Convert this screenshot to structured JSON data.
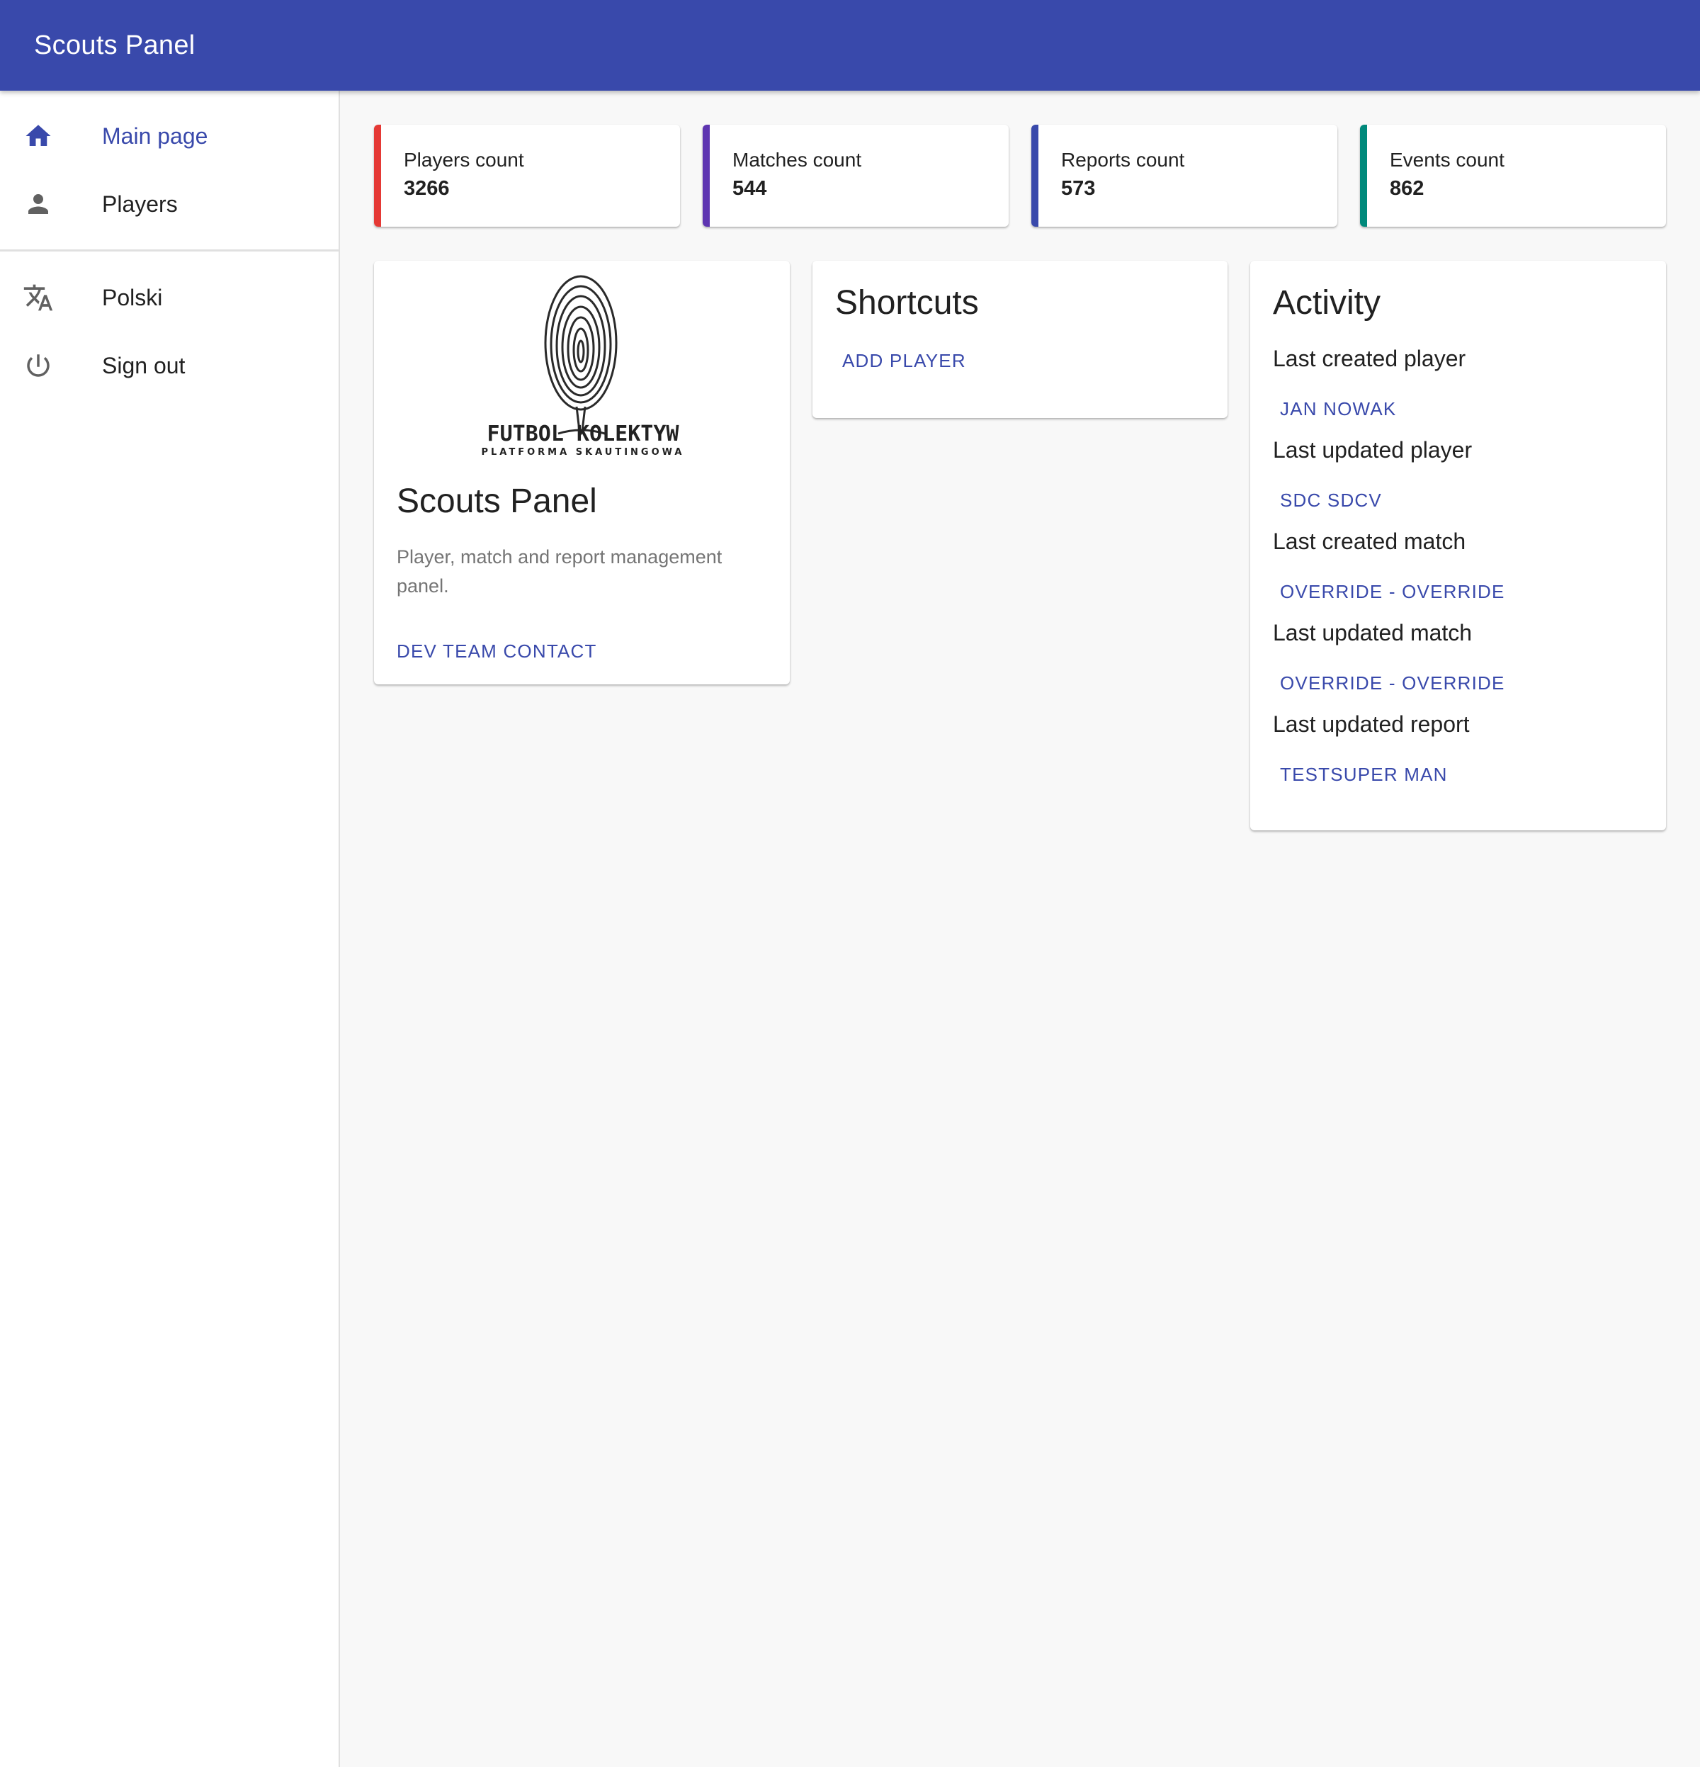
{
  "app": {
    "title": "Scouts Panel"
  },
  "sidebar": {
    "items": [
      {
        "label": "Main page",
        "icon": "home-icon",
        "active": true
      },
      {
        "label": "Players",
        "icon": "person-icon",
        "active": false
      },
      {
        "label": "Polski",
        "icon": "translate-icon",
        "active": false
      },
      {
        "label": "Sign out",
        "icon": "power-icon",
        "active": false
      }
    ]
  },
  "stats": [
    {
      "label": "Players count",
      "value": "3266",
      "color": "#e53935"
    },
    {
      "label": "Matches count",
      "value": "544",
      "color": "#5e35b1"
    },
    {
      "label": "Reports count",
      "value": "573",
      "color": "#3949ab"
    },
    {
      "label": "Events count",
      "value": "862",
      "color": "#00897b"
    }
  ],
  "about": {
    "logo_text": "FUTBOL KOLEKTYW",
    "logo_subtext": "PLATFORMA SKAUTINGOWA",
    "title": "Scouts Panel",
    "description": "Player, match and report management panel.",
    "contact_label": "DEV TEAM CONTACT"
  },
  "shortcuts": {
    "title": "Shortcuts",
    "add_player_label": "ADD PLAYER"
  },
  "activity": {
    "title": "Activity",
    "entries": [
      {
        "label": "Last created player",
        "link": "JAN NOWAK"
      },
      {
        "label": "Last updated player",
        "link": "SDC SDCV"
      },
      {
        "label": "Last created match",
        "link": "OVERRIDE - OVERRIDE"
      },
      {
        "label": "Last updated match",
        "link": "OVERRIDE - OVERRIDE"
      },
      {
        "label": "Last updated report",
        "link": "TESTSUPER MAN"
      }
    ]
  },
  "colors": {
    "primary": "#3949ab",
    "background": "#f8f8f8"
  }
}
